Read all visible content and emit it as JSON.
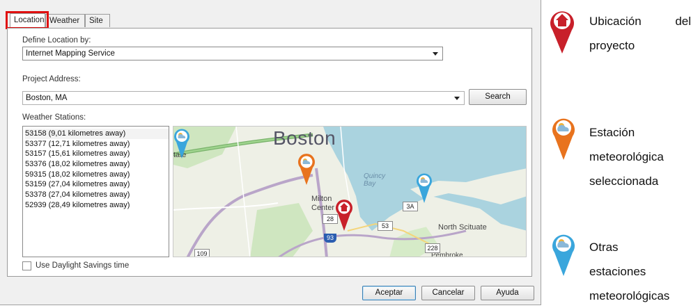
{
  "tabs": [
    {
      "label": "Location",
      "active": true
    },
    {
      "label": "Weather",
      "active": false
    },
    {
      "label": "Site",
      "active": false
    }
  ],
  "define_location": {
    "label": "Define Location by:",
    "value": "Internet Mapping Service"
  },
  "project_address": {
    "label": "Project Address:",
    "value": "Boston, MA",
    "search_label": "Search"
  },
  "weather_stations": {
    "label": "Weather Stations:",
    "items": [
      "53158 (9,01 kilometres away)",
      "53377 (12,71 kilometres away)",
      "53157 (15,61 kilometres away)",
      "53376 (18,02 kilometres away)",
      "59315 (18,02 kilometres away)",
      "53159 (27,04 kilometres away)",
      "53378 (27,04 kilometres away)",
      "52939 (28,49 kilometres away)"
    ],
    "selected_index": 0
  },
  "map": {
    "city": "Boston",
    "bay": "Quincy Bay",
    "milton": "Milton",
    "milton_center": "Center",
    "north_scituate": "North Scituate",
    "pembroke": "Pembroke",
    "partial_left": "tate",
    "shields": [
      "28",
      "3A",
      "53",
      "228",
      "109",
      "93"
    ]
  },
  "daylight_savings_label": "Use Daylight Savings time",
  "buttons": {
    "ok": "Aceptar",
    "cancel": "Cancelar",
    "help": "Ayuda"
  },
  "legend": {
    "project_location": [
      "Ubicación",
      "del",
      "proyecto"
    ],
    "selected_station": [
      "Estación",
      "meteorológica",
      "seleccionada"
    ],
    "other_stations": [
      "Otras",
      "estaciones",
      "meteorológicas"
    ]
  },
  "colors": {
    "project_pin": "#c8202a",
    "selected_station_pin": "#e8731e",
    "other_station_pin": "#3aa6dc",
    "tab_highlight": "#e01010"
  }
}
